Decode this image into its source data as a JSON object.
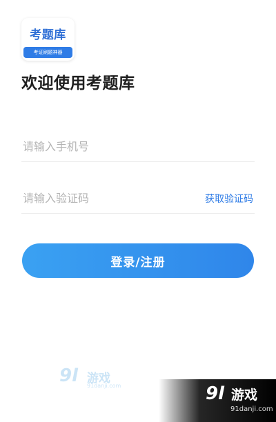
{
  "logo": {
    "title": "考题库",
    "tagline": "考证刷题神器"
  },
  "welcome_text": "欢迎使用考题库",
  "phone_field": {
    "placeholder": "请输入手机号",
    "value": ""
  },
  "code_field": {
    "placeholder": "请输入验证码",
    "value": "",
    "get_code_label": "获取验证码"
  },
  "login_button_label": "登录/注册",
  "watermark": {
    "number": "9l",
    "brand": "游戏",
    "domain": "91danji.com"
  },
  "colors": {
    "accent": "#2f7ce6",
    "button_start": "#3aa1f2",
    "button_end": "#2f86ea"
  }
}
